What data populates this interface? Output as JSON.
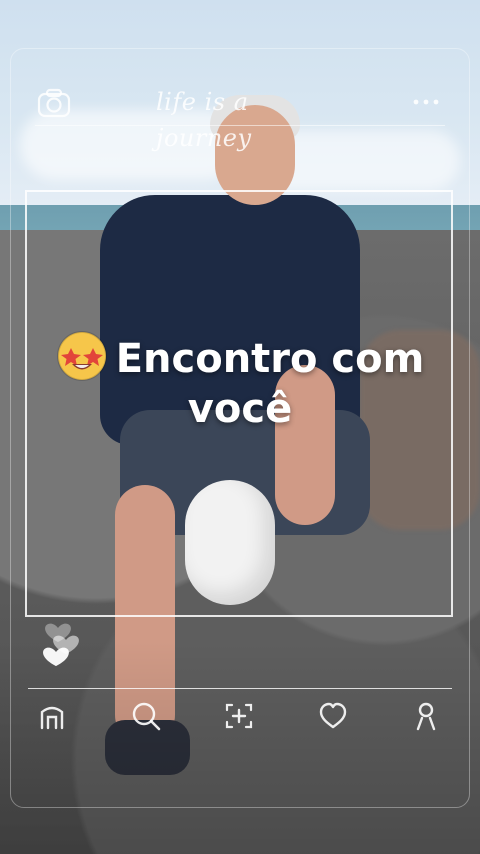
{
  "header": {
    "app_title": "life is a journey",
    "left_icon": "camera-icon",
    "right_icon": "more-icon"
  },
  "caption": {
    "emoji": "star-struck-emoji",
    "line1": "Encontro com",
    "line2": "você"
  },
  "likes": {
    "icon": "hearts-icon"
  },
  "bottom_nav": {
    "items": [
      {
        "icon": "home-icon"
      },
      {
        "icon": "search-icon"
      },
      {
        "icon": "add-icon"
      },
      {
        "icon": "heart-icon"
      },
      {
        "icon": "profile-icon"
      }
    ]
  },
  "colors": {
    "overlay_white": "#FFFFFF"
  }
}
